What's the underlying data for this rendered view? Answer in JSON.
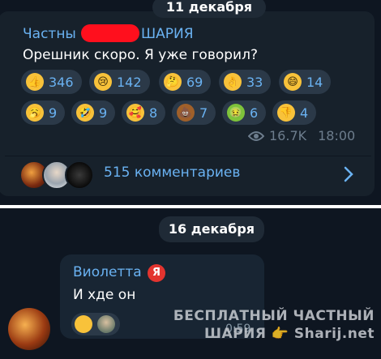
{
  "post": {
    "date": "11 декабря",
    "channel_name_start": "Частны",
    "channel_name_end": "ШАРИЯ",
    "text": "Орешник скоро. Я уже говорил?",
    "reactions": [
      {
        "icon": "thumbs-up-icon",
        "count": "346"
      },
      {
        "icon": "crying-face-icon",
        "count": "142"
      },
      {
        "icon": "thinking-face-icon",
        "count": "69"
      },
      {
        "icon": "ok-hand-icon",
        "count": "33"
      },
      {
        "icon": "grinning-face-icon",
        "count": "14"
      },
      {
        "icon": "yawning-face-icon",
        "count": "9"
      },
      {
        "icon": "rolling-laughing-face-icon",
        "count": "9"
      },
      {
        "icon": "hugging-face-icon",
        "count": "8"
      },
      {
        "icon": "poop-icon",
        "count": "7"
      },
      {
        "icon": "nauseated-face-icon",
        "count": "6"
      },
      {
        "icon": "thumbs-down-icon",
        "count": "4"
      }
    ],
    "views": "16.7K",
    "time": "18:00",
    "comments_label": "515 комментариев"
  },
  "message": {
    "date": "16 декабря",
    "sender": "Виолетта",
    "sender_badge": "Я",
    "text": "И хде он",
    "time": "0:59"
  },
  "watermark": {
    "line1": "БЕСПЛАТНЫЙ ЧАСТНЫЙ",
    "line2": "ШАРИЯ 👉 Sharij.net"
  },
  "colors": {
    "background": "#0e1621",
    "bubble": "#17212b",
    "accent": "#6ab2f2",
    "redaction": "#ff0f1d"
  }
}
